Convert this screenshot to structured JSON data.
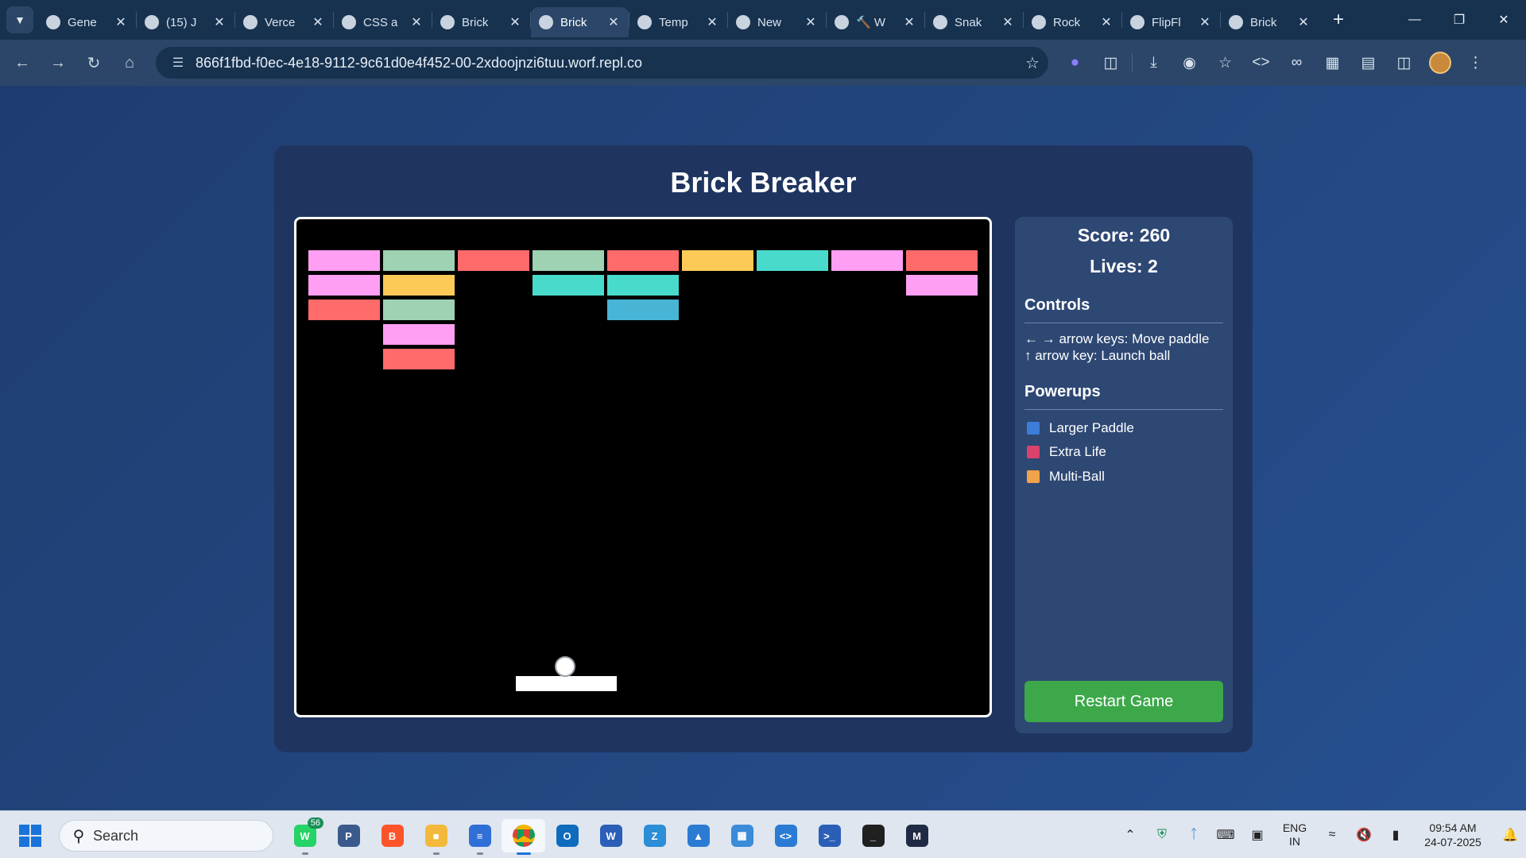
{
  "browser": {
    "tabs": [
      {
        "title": "Gene",
        "icon": "github-icon",
        "active": false
      },
      {
        "title": "(15) J",
        "icon": "linkedin-icon",
        "active": false
      },
      {
        "title": "Verce",
        "icon": "vercel-icon",
        "active": false
      },
      {
        "title": "CSS a",
        "icon": "openai-icon",
        "active": false
      },
      {
        "title": "Brick",
        "icon": "replit-icon",
        "active": false
      },
      {
        "title": "Brick",
        "icon": "globe-icon",
        "active": true
      },
      {
        "title": "Temp",
        "icon": "ecosia-icon",
        "active": false
      },
      {
        "title": "New",
        "icon": "chrome-icon",
        "active": false
      },
      {
        "title": "🔨 W",
        "icon": "globe-icon",
        "active": false
      },
      {
        "title": "Snak",
        "icon": "snake-icon",
        "active": false
      },
      {
        "title": "Rock",
        "icon": "game-icon",
        "active": false
      },
      {
        "title": "FlipFl",
        "icon": "globe-icon",
        "active": false
      },
      {
        "title": "Brick",
        "icon": "globe-icon",
        "active": false
      }
    ],
    "url": "866f1fbd-f0ec-4e18-9112-9c61d0e4f452-00-2xdoojnzi6tuu.worf.repl.co"
  },
  "game": {
    "title": "Brick Breaker",
    "score_text": "Score: 260",
    "lives_text": "Lives: 2",
    "score": 260,
    "lives": 2,
    "controls_title": "Controls",
    "controls": [
      "← → arrow keys: Move paddle",
      "↑ arrow key: Launch ball"
    ],
    "powerups_title": "Powerups",
    "powerups": [
      {
        "label": "Larger Paddle",
        "color": "#3b7dd8"
      },
      {
        "label": "Extra Life",
        "color": "#d9436b"
      },
      {
        "label": "Multi-Ball",
        "color": "#f0a34a"
      }
    ],
    "restart_label": "Restart Game",
    "brick_colors": {
      "pink": "#ff9ff3",
      "mint": "#9ed2b3",
      "red": "#ff6b6b",
      "yellow": "#feca57",
      "teal": "#48dbcb",
      "blue": "#48b5d6"
    },
    "bricks": [
      {
        "col": 0,
        "row": 0,
        "color": "pink"
      },
      {
        "col": 1,
        "row": 0,
        "color": "mint"
      },
      {
        "col": 2,
        "row": 0,
        "color": "red"
      },
      {
        "col": 3,
        "row": 0,
        "color": "mint"
      },
      {
        "col": 4,
        "row": 0,
        "color": "red"
      },
      {
        "col": 5,
        "row": 0,
        "color": "yellow"
      },
      {
        "col": 6,
        "row": 0,
        "color": "teal"
      },
      {
        "col": 7,
        "row": 0,
        "color": "pink"
      },
      {
        "col": 8,
        "row": 0,
        "color": "red"
      },
      {
        "col": 0,
        "row": 1,
        "color": "pink"
      },
      {
        "col": 1,
        "row": 1,
        "color": "yellow"
      },
      {
        "col": 3,
        "row": 1,
        "color": "teal"
      },
      {
        "col": 4,
        "row": 1,
        "color": "teal"
      },
      {
        "col": 8,
        "row": 1,
        "color": "pink"
      },
      {
        "col": 0,
        "row": 2,
        "color": "red"
      },
      {
        "col": 1,
        "row": 2,
        "color": "mint"
      },
      {
        "col": 4,
        "row": 2,
        "color": "blue"
      },
      {
        "col": 1,
        "row": 3,
        "color": "pink"
      },
      {
        "col": 1,
        "row": 4,
        "color": "red"
      }
    ]
  },
  "taskbar": {
    "search_label": "Search",
    "whatsapp_badge": "56",
    "apps": [
      "whatsapp-icon",
      "file-manager-icon",
      "brave-icon",
      "folder-icon",
      "notepad-icon",
      "chrome-icon",
      "outlook-icon",
      "word-icon",
      "zoom-icon",
      "photos-icon",
      "control-panel-icon",
      "vscode-icon",
      "powershell-icon",
      "terminal-icon",
      "mysql-icon"
    ],
    "lang_line1": "ENG",
    "lang_line2": "IN",
    "time": "09:54 AM",
    "date": "24-07-2025"
  }
}
